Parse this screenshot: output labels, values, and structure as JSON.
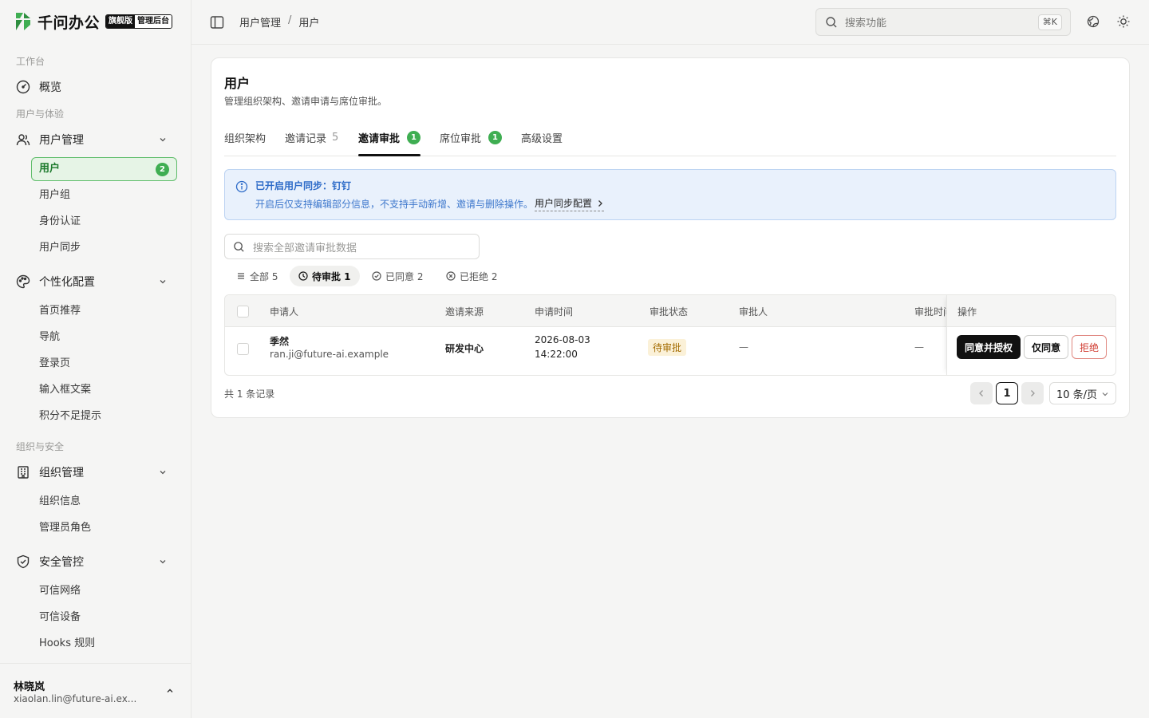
{
  "brand": {
    "name": "千问办公",
    "tag_edition": "旗舰版",
    "tag_console": "管理后台"
  },
  "sidebar": {
    "sections": {
      "workbench": "工作台",
      "users_experience": "用户与体验",
      "org_security": "组织与安全"
    },
    "overview": "概览",
    "user_mgmt": {
      "label": "用户管理",
      "items": [
        "用户",
        "用户组",
        "身份认证",
        "用户同步"
      ],
      "active_badge": "2"
    },
    "personalize": {
      "label": "个性化配置",
      "items": [
        "首页推荐",
        "导航",
        "登录页",
        "输入框文案",
        "积分不足提示"
      ]
    },
    "org_mgmt": {
      "label": "组织管理",
      "items": [
        "组织信息",
        "管理员角色"
      ]
    },
    "security": {
      "label": "安全管控",
      "items": [
        "可信网络",
        "可信设备",
        "Hooks 规则"
      ]
    },
    "footer": {
      "name": "林晓岚",
      "email": "xiaolan.lin@future-ai.ex..."
    }
  },
  "topbar": {
    "breadcrumb": [
      "用户管理",
      "/",
      "用户"
    ],
    "search_placeholder": "搜索功能",
    "shortcut": "⌘K"
  },
  "page": {
    "title": "用户",
    "subtitle": "管理组织架构、邀请申请与席位审批。",
    "tabs": [
      {
        "label": "组织架构"
      },
      {
        "label": "邀请记录",
        "count": "5"
      },
      {
        "label": "邀请审批",
        "badge": "1"
      },
      {
        "label": "席位审批",
        "badge": "1"
      },
      {
        "label": "高级设置"
      }
    ],
    "info": {
      "title": "已开启用户同步：钉钉",
      "text": "开启后仅支持编辑部分信息，不支持手动新增、邀请与删除操作。",
      "link": "用户同步配置"
    },
    "filter_placeholder": "搜索全部邀请审批数据",
    "segments": [
      {
        "label": "全部 5"
      },
      {
        "label": "待审批 1"
      },
      {
        "label": "已同意 2"
      },
      {
        "label": "已拒绝 2"
      }
    ],
    "table": {
      "headers": [
        "申请人",
        "邀请来源",
        "申请时间",
        "审批状态",
        "审批人",
        "审批时间",
        "操作"
      ],
      "rows": [
        {
          "name": "季然",
          "email": "ran.ji@future-ai.example",
          "source": "研发中心",
          "date": "2026-08-03",
          "time": "14:22:00",
          "status": "待审批",
          "approver": "—",
          "approve_time": "—"
        }
      ],
      "actions": {
        "approve_grant": "同意并授权",
        "approve_only": "仅同意",
        "reject": "拒绝"
      }
    },
    "pagination": {
      "total": "共 1 条记录",
      "current": "1",
      "page_size": "10 条/页"
    }
  }
}
